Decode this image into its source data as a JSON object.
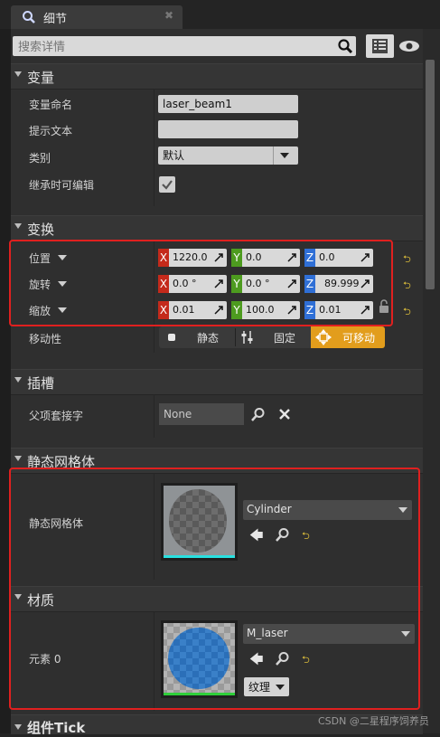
{
  "tab": {
    "title": "细节"
  },
  "search": {
    "placeholder": "搜索详情"
  },
  "categories": {
    "variable": "变量",
    "transform": "变换",
    "sockets": "插槽",
    "static_mesh": "静态网格体",
    "materials": "材质",
    "component_tick": "组件Tick"
  },
  "variable": {
    "name_label": "变量命名",
    "name_value": "laser_beam1",
    "tooltip_label": "提示文本",
    "tooltip_value": "",
    "category_label": "类别",
    "category_value": "默认",
    "editable_label": "继承时可编辑",
    "editable_checked": true
  },
  "transform": {
    "location_label": "位置",
    "location": {
      "x": "1220.0",
      "y": "0.0",
      "z": "0.0"
    },
    "rotation_label": "旋转",
    "rotation": {
      "x": "0.0 °",
      "y": "0.0 °",
      "z": "89.999"
    },
    "scale_label": "缩放",
    "scale": {
      "x": "0.01",
      "y": "100.0",
      "z": "0.01"
    },
    "axis_x": "X",
    "axis_y": "Y",
    "axis_z": "Z",
    "mobility_label": "移动性",
    "mobility_options": [
      "静态",
      "固定",
      "可移动"
    ],
    "mobility_selected": "可移动"
  },
  "sockets": {
    "parent_socket_label": "父项套接字",
    "parent_socket_value": "None"
  },
  "static_mesh": {
    "label": "静态网格体",
    "value": "Cylinder"
  },
  "materials": {
    "element_label": "元素 0",
    "value": "M_laser",
    "texture_button": "纹理"
  },
  "watermark": "CSDN @二星程序饲养员",
  "colors": {
    "highlight_border": "#e0201f",
    "axis_x": "#c42a1b",
    "axis_y": "#4d9b1f",
    "axis_z": "#2f6fd6",
    "mobility_selected": "#e29d1c"
  }
}
